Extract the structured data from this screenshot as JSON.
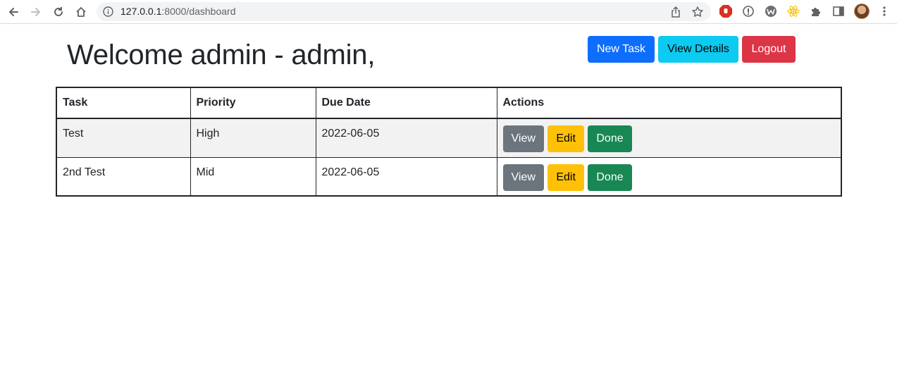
{
  "browser": {
    "url_host": "127.0.0.1",
    "url_path": ":8000/dashboard"
  },
  "header": {
    "welcome": "Welcome admin - admin,",
    "new_task_label": "New Task",
    "view_details_label": "View Details",
    "logout_label": "Logout"
  },
  "table": {
    "columns": [
      "Task",
      "Priority",
      "Due Date",
      "Actions"
    ],
    "rows": [
      {
        "task": "Test",
        "priority": "High",
        "due_date": "2022-06-05"
      },
      {
        "task": "2nd Test",
        "priority": "Mid",
        "due_date": "2022-06-05"
      }
    ],
    "action_labels": {
      "view": "View",
      "edit": "Edit",
      "done": "Done"
    }
  },
  "colors": {
    "primary": "#0d6efd",
    "info": "#0dcaf0",
    "danger": "#dc3545",
    "secondary": "#6c757d",
    "warning": "#ffc107",
    "success": "#198754"
  }
}
